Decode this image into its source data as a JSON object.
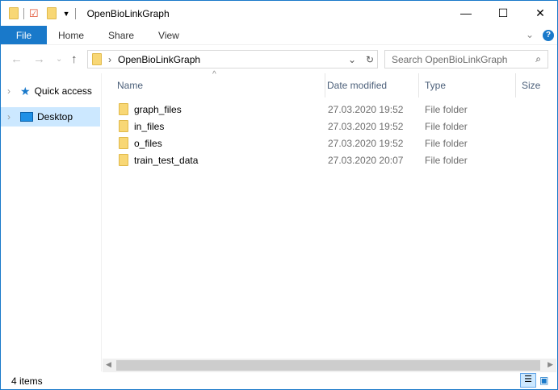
{
  "window": {
    "title": "OpenBioLinkGraph"
  },
  "ribbon": {
    "tabs": [
      "File",
      "Home",
      "Share",
      "View"
    ]
  },
  "address": {
    "path": "OpenBioLinkGraph",
    "search_placeholder": "Search OpenBioLinkGraph"
  },
  "sidebar": {
    "items": [
      {
        "label": "Quick access",
        "icon": "star-icon"
      },
      {
        "label": "Desktop",
        "icon": "desktop-icon",
        "selected": true
      }
    ]
  },
  "columns": [
    "Name",
    "Date modified",
    "Type",
    "Size"
  ],
  "files": [
    {
      "name": "graph_files",
      "date": "27.03.2020 19:52",
      "type": "File folder"
    },
    {
      "name": "in_files",
      "date": "27.03.2020 19:52",
      "type": "File folder"
    },
    {
      "name": "o_files",
      "date": "27.03.2020 19:52",
      "type": "File folder"
    },
    {
      "name": "train_test_data",
      "date": "27.03.2020 20:07",
      "type": "File folder"
    }
  ],
  "status": {
    "count": "4 items"
  },
  "colors": {
    "accent": "#1979ca",
    "selection": "#cce8ff"
  }
}
